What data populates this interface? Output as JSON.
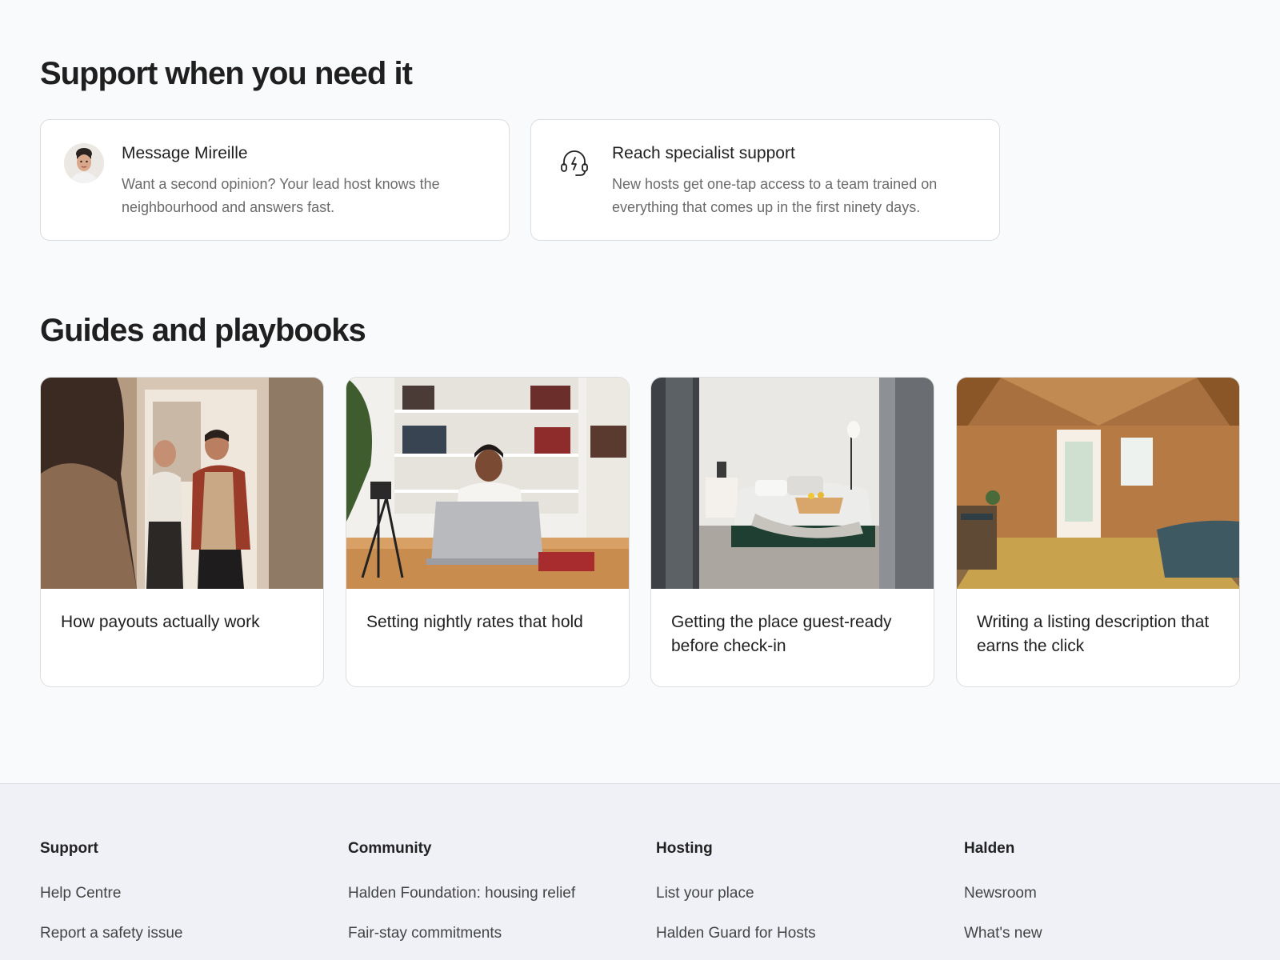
{
  "support": {
    "heading": "Support when you need it",
    "cards": [
      {
        "title": "Message Mireille",
        "description": "Want a second opinion? Your lead host knows the neighbourhood and answers fast.",
        "icon": "avatar"
      },
      {
        "title": "Reach specialist support",
        "description": "New hosts get one-tap access to a team trained on everything that comes up in the first ninety days.",
        "icon": "headset-icon"
      }
    ]
  },
  "guides": {
    "heading": "Guides and playbooks",
    "cards": [
      {
        "title": "How payouts actually work"
      },
      {
        "title": "Setting nightly rates that hold"
      },
      {
        "title": "Getting the place guest-ready before check-in"
      },
      {
        "title": "Writing a listing description that earns the click"
      }
    ]
  },
  "footer": {
    "columns": [
      {
        "heading": "Support",
        "links": [
          "Help Centre",
          "Report a safety issue"
        ]
      },
      {
        "heading": "Community",
        "links": [
          "Halden Foundation: housing relief",
          "Fair-stay commitments"
        ]
      },
      {
        "heading": "Hosting",
        "links": [
          "List your place",
          "Halden Guard for Hosts"
        ]
      },
      {
        "heading": "Halden",
        "links": [
          "Newsroom",
          "What's new"
        ]
      }
    ]
  },
  "colors": {
    "page_background": "#f9fafc",
    "footer_background": "#eff1f7",
    "card_border": "#dddddd",
    "heading_text": "#1f1f1f",
    "muted_text": "#6a6a6a"
  }
}
